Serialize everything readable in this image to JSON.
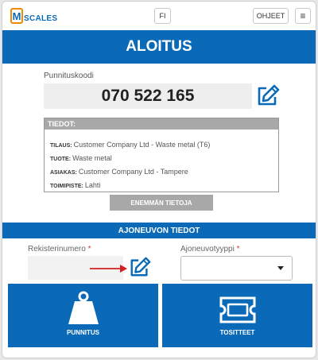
{
  "topbar": {
    "logo_letter": "M",
    "logo_text": "SCALES",
    "language": "FI",
    "help_label": "OHJEET",
    "menu_glyph": "≡"
  },
  "header": {
    "title": "ALOITUS"
  },
  "weighing": {
    "code_label": "Punnituskoodi",
    "code_value": "070 522 165",
    "edit_icon": "edit-icon"
  },
  "info": {
    "title": "TIEDOT:",
    "rows": [
      {
        "key": "TILAUS:",
        "value": "Customer Company Ltd - Waste metal (T6)"
      },
      {
        "key": "TUOTE:",
        "value": "Waste metal"
      },
      {
        "key": "ASIAKAS:",
        "value": "Customer Company Ltd - Tampere"
      },
      {
        "key": "TOIMIPISTE:",
        "value": "Lahti"
      }
    ],
    "more_label": "ENEMMÄN TIETOJA"
  },
  "vehicle": {
    "section_title": "AJONEUVON TIEDOT",
    "reg_label": "Rekisterinumero",
    "type_label": "Ajoneuvotyyppi",
    "required_mark": "*",
    "type_value": ""
  },
  "actions": {
    "weighing_label": "PUNNITUS",
    "receipts_label": "TOSITTEET"
  },
  "colors": {
    "brand_blue": "#0a6ab7",
    "logo_orange": "#f08a00",
    "info_grey": "#a8a8a8",
    "arrow_red": "#d42020"
  }
}
